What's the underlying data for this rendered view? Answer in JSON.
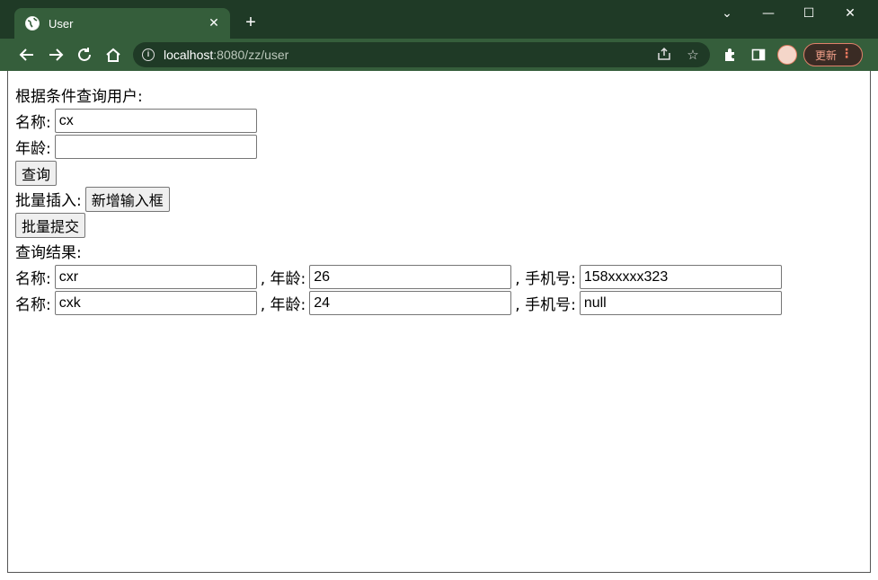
{
  "browser": {
    "tab_title": "User",
    "tab_close": "✕",
    "new_tab": "+",
    "url_host": "localhost",
    "url_rest": ":8080/zz/user",
    "update_label": "更新",
    "update_menu": "⋮",
    "window_controls": {
      "chevron": "⌄",
      "minimize": "—",
      "maximize": "☐",
      "close": "✕"
    }
  },
  "page": {
    "heading": "根据条件查询用户:",
    "query": {
      "name_label": "名称:",
      "name_value": "cx",
      "age_label": "年龄:",
      "age_value": "",
      "submit_label": "查询"
    },
    "batch": {
      "label": "批量插入:",
      "add_button": "新增输入框",
      "submit_button": "批量提交"
    },
    "results_heading": "查询结果:",
    "results": [
      {
        "name_label": "名称:",
        "name": "cxr",
        "age_label": ", 年龄:",
        "age": "26",
        "phone_label": ", 手机号:",
        "phone": "158xxxxx323"
      },
      {
        "name_label": "名称:",
        "name": "cxk",
        "age_label": ", 年龄:",
        "age": "24",
        "phone_label": ", 手机号:",
        "phone": "null"
      }
    ]
  },
  "colors": {
    "titlebar": "#1f3a26",
    "toolbar": "#355e3b",
    "update_accent": "#e0806a"
  }
}
